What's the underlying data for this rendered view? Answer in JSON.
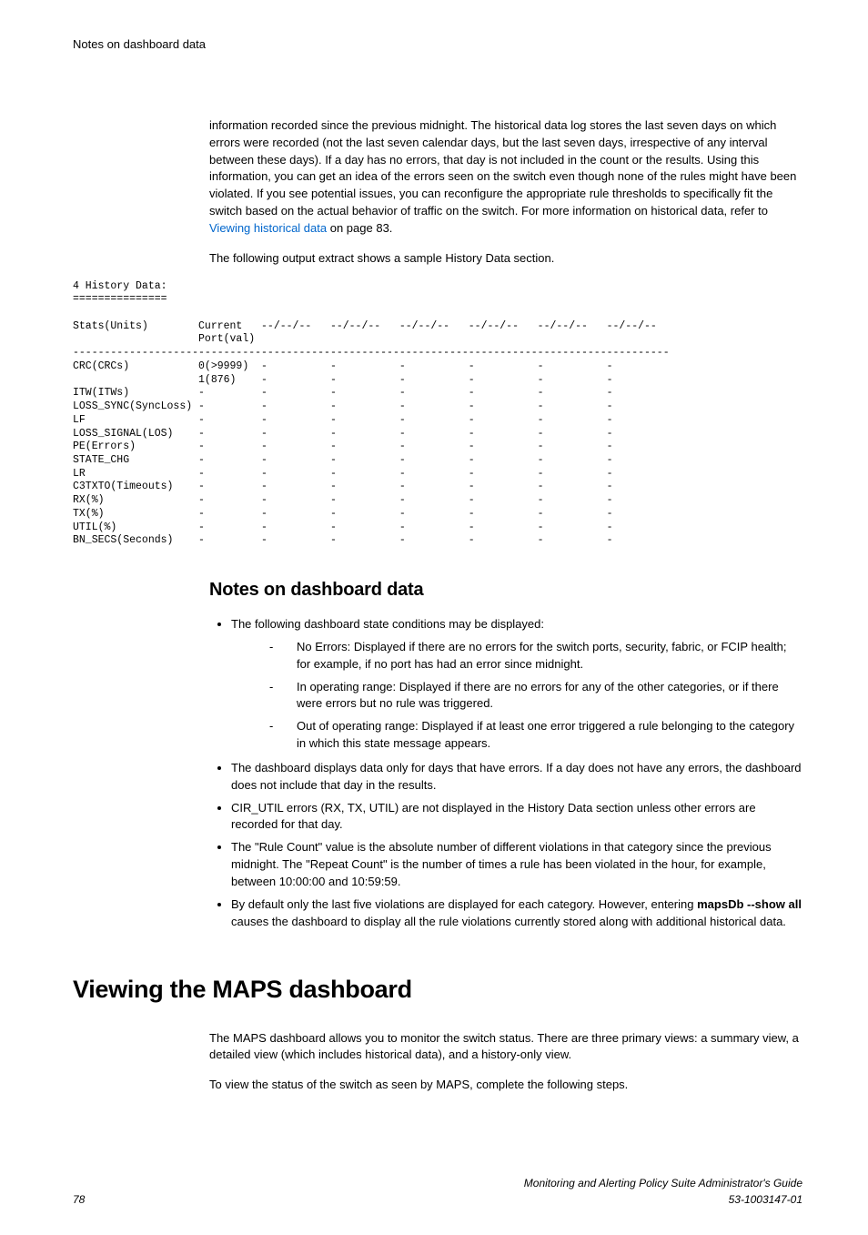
{
  "header": {
    "section_title": "Notes on dashboard data"
  },
  "intro": {
    "p1_pre": "information recorded since the previous midnight. The historical data log stores the last seven days on which errors were recorded (not the last seven calendar days, but the last seven days, irrespective of any interval between these days). If a day has no errors, that day is not included in the count or the results. Using this information, you can get an idea of the errors seen on the switch even though none of the rules might have been violated. If you see potential issues, you can reconfigure the appropriate rule thresholds to specifically fit the switch based on the actual behavior of traffic on the switch. For more information on historical data, refer to ",
    "p1_link": "Viewing historical data",
    "p1_post": " on page 83.",
    "p2": "The following output extract shows a sample History Data section."
  },
  "code_block": "4 History Data:\n===============\n\nStats(Units)        Current   --/--/--   --/--/--   --/--/--   --/--/--   --/--/--   --/--/--\n                    Port(val)\n-----------------------------------------------------------------------------------------------\nCRC(CRCs)           0(>9999)  -          -          -          -          -          -\n                    1(876)    -          -          -          -          -          -\nITW(ITWs)           -         -          -          -          -          -          -\nLOSS_SYNC(SyncLoss) -         -          -          -          -          -          -\nLF                  -         -          -          -          -          -          -\nLOSS_SIGNAL(LOS)    -         -          -          -          -          -          -\nPE(Errors)          -         -          -          -          -          -          -\nSTATE_CHG           -         -          -          -          -          -          -\nLR                  -         -          -          -          -          -          -\nC3TXTO(Timeouts)    -         -          -          -          -          -          -\nRX(%)               -         -          -          -          -          -          -\nTX(%)               -         -          -          -          -          -          -\nUTIL(%)             -         -          -          -          -          -          -\nBN_SECS(Seconds)    -         -          -          -          -          -          -",
  "notes": {
    "heading": "Notes on dashboard data",
    "b1": "The following dashboard state conditions may be displayed:",
    "sb1": "No Errors: Displayed if there are no errors for the switch ports, security, fabric, or FCIP health; for example, if no port has had an error since midnight.",
    "sb2": "In operating range: Displayed if there are no errors for any of the other categories, or if there were errors but no rule was triggered.",
    "sb3": "Out of operating range: Displayed if at least one error triggered a rule belonging to the category in which this state message appears.",
    "b2": "The dashboard displays data only for days that have errors. If a day does not have any errors, the dashboard does not include that day in the results.",
    "b3": "CIR_UTIL errors (RX, TX, UTIL) are not displayed in the History Data section unless other errors are recorded for that day.",
    "b4": "The \"Rule Count\" value is the absolute number of different violations in that category since the previous midnight. The \"Repeat Count\" is the number of times a rule has been violated in the hour, for example, between 10:00:00 and 10:59:59.",
    "b5_pre": "By default only the last five violations are displayed for each category. However, entering ",
    "b5_bold": "mapsDb --show all",
    "b5_post": " causes the dashboard to display all the rule violations currently stored along with additional historical data."
  },
  "viewing": {
    "heading": "Viewing the MAPS dashboard",
    "p1": "The MAPS dashboard allows you to monitor the switch status. There are three primary views: a summary view, a detailed view (which includes historical data), and a history-only view.",
    "p2": "To view the status of the switch as seen by MAPS, complete the following steps."
  },
  "footer": {
    "page": "78",
    "guide": "Monitoring and Alerting Policy Suite Administrator's Guide",
    "docnum": "53-1003147-01"
  }
}
